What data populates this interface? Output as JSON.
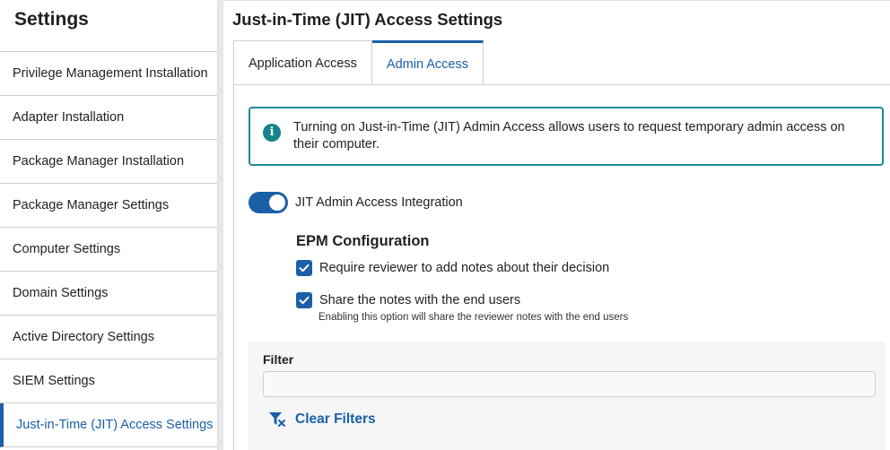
{
  "sidebar": {
    "title": "Settings",
    "items": [
      {
        "label": "Privilege Management Installation"
      },
      {
        "label": "Adapter Installation"
      },
      {
        "label": "Package Manager Installation"
      },
      {
        "label": "Package Manager Settings"
      },
      {
        "label": "Computer Settings"
      },
      {
        "label": "Domain Settings"
      },
      {
        "label": "Active Directory Settings"
      },
      {
        "label": "SIEM Settings"
      },
      {
        "label": "Just-in-Time (JIT) Access Settings"
      }
    ],
    "active_index": 8
  },
  "main": {
    "title": "Just-in-Time (JIT) Access Settings",
    "tabs": [
      {
        "label": "Application Access",
        "active": false
      },
      {
        "label": "Admin Access",
        "active": true
      }
    ],
    "info": {
      "icon": "info-icon",
      "text": "Turning on Just-in-Time (JIT) Admin Access allows users to request temporary admin access on their computer."
    },
    "toggle": {
      "label": "JIT Admin Access Integration",
      "on": true
    },
    "epm": {
      "title": "EPM Configuration",
      "options": [
        {
          "label": "Require reviewer to add notes about their decision",
          "checked": true
        },
        {
          "label": "Share the notes with the end users",
          "checked": true,
          "help": "Enabling this option will share the reviewer notes with the end users"
        }
      ]
    },
    "filter": {
      "label": "Filter",
      "value": "",
      "placeholder": "",
      "clear_label": "Clear Filters",
      "clear_icon": "clear-filter-icon"
    }
  },
  "colors": {
    "accent": "#1a5fa8",
    "info_border": "#1a8a8f"
  }
}
